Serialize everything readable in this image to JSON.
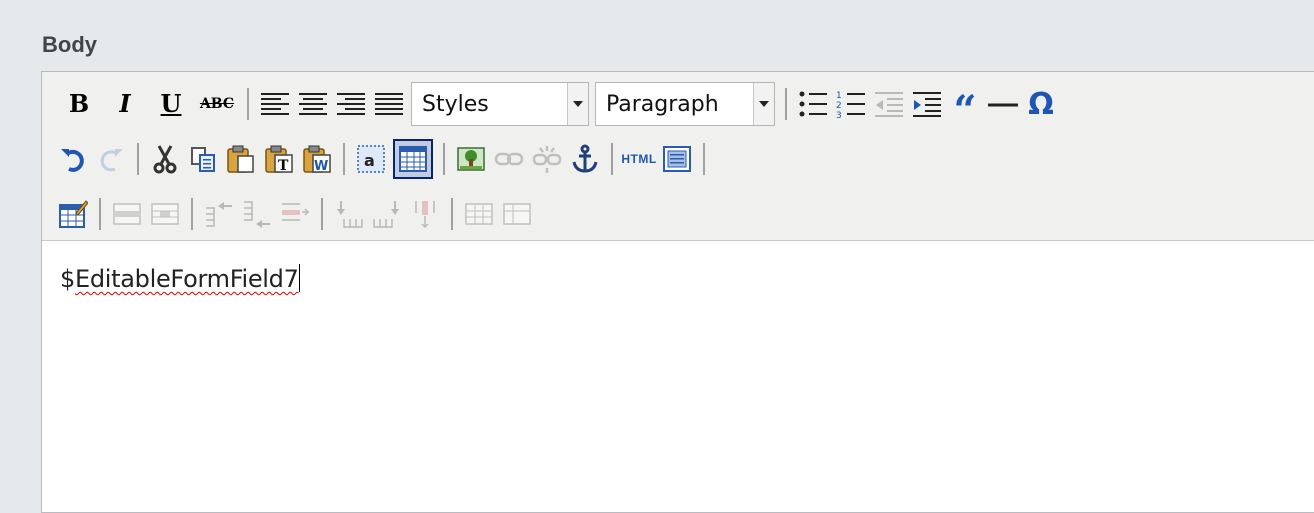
{
  "field": {
    "label": "Body"
  },
  "toolbar": {
    "bold": "B",
    "italic": "I",
    "underline": "U",
    "strikethrough": "ABC",
    "styles_select": {
      "value": "Styles"
    },
    "format_select": {
      "value": "Paragraph"
    },
    "html_label": "HTML",
    "blockquote": "“",
    "hr": "—",
    "charmap": "Ω"
  },
  "content": {
    "prefix": "$",
    "word": "EditableFormField7"
  },
  "colors": {
    "background": "#e6e9ec",
    "toolbar": "#f0f0ee",
    "icon_blue": "#1f56b3",
    "active_border": "#0a246a"
  }
}
